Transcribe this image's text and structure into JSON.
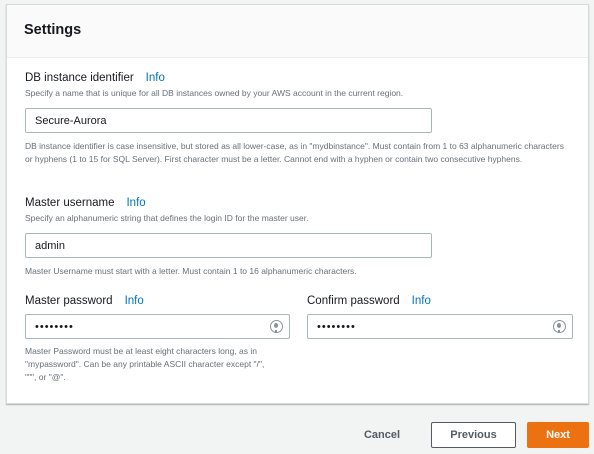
{
  "settings": {
    "title": "Settings",
    "db_identifier": {
      "label": "DB instance identifier",
      "info": "Info",
      "description": "Specify a name that is unique for all DB instances owned by your AWS account in the current region.",
      "value": "Secure-Aurora",
      "hint": "DB instance identifier is case insensitive, but stored as all lower-case, as in \"mydbinstance\". Must contain from 1 to 63 alphanumeric characters or hyphens (1 to 15 for SQL Server). First character must be a letter. Cannot end with a hyphen or contain two consecutive hyphens."
    },
    "master_username": {
      "label": "Master username",
      "info": "Info",
      "description": "Specify an alphanumeric string that defines the login ID for the master user.",
      "value": "admin",
      "hint": "Master Username must start with a letter. Must contain 1 to 16 alphanumeric characters."
    },
    "master_password": {
      "label": "Master password",
      "info": "Info",
      "value": "••••••••",
      "hint": "Master Password must be at least eight characters long, as in \"mypassword\". Can be any printable ASCII character except \"/\", \"\"\", or \"@\"."
    },
    "confirm_password": {
      "label": "Confirm password",
      "info": "Info",
      "value": "••••••••"
    }
  },
  "footer": {
    "cancel_label": "Cancel",
    "previous_label": "Previous",
    "next_label": "Next"
  },
  "colors": {
    "accent": "#ec7211",
    "link": "#0073bb"
  },
  "icons": {
    "password_toggle": "eye-icon"
  }
}
